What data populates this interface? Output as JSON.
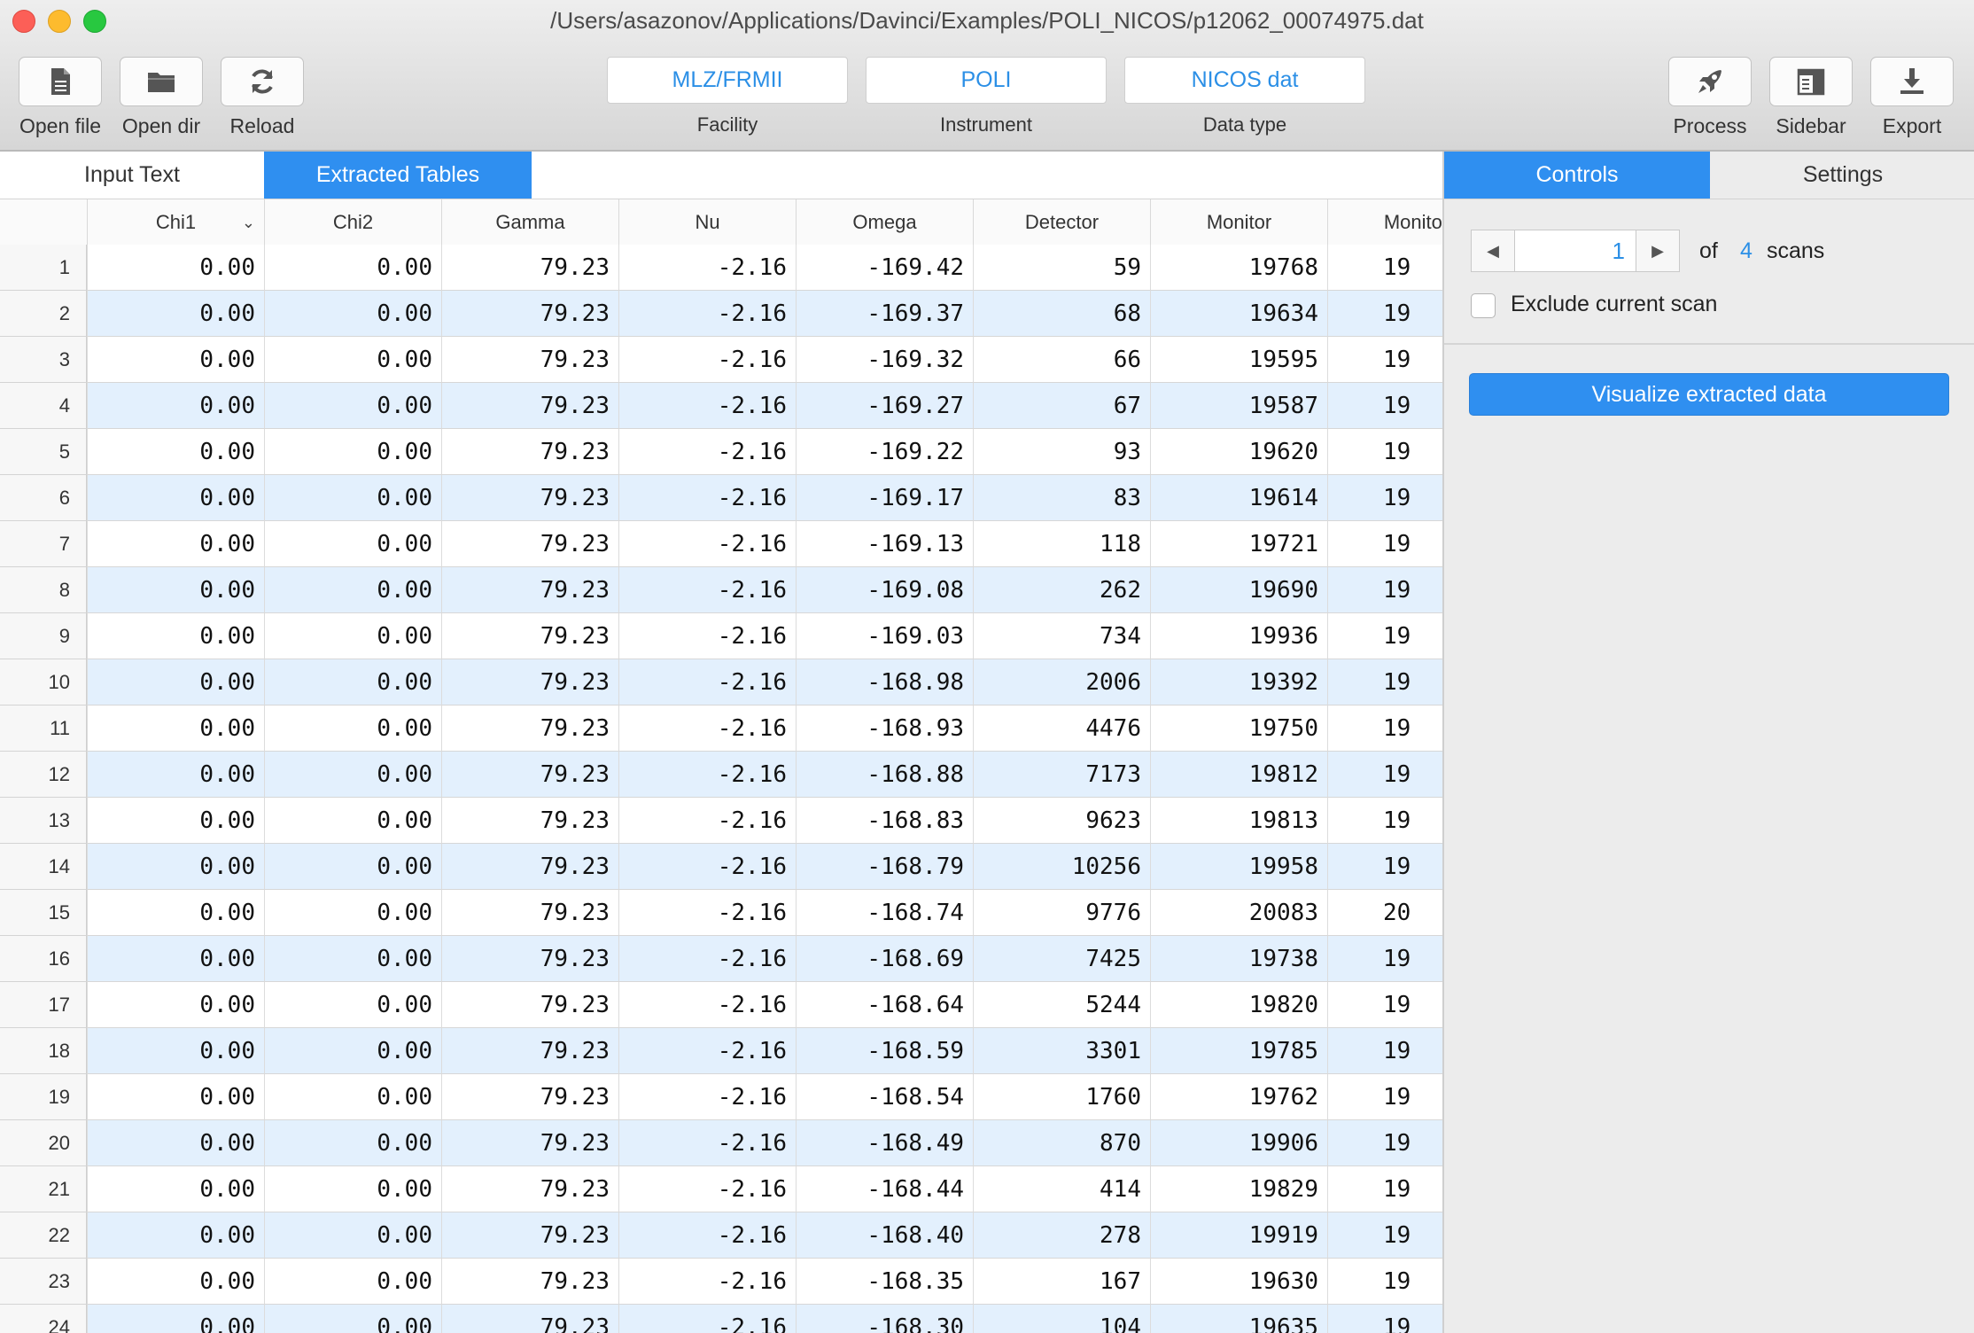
{
  "window": {
    "title": "/Users/asazonov/Applications/Davinci/Examples/POLI_NICOS/p12062_00074975.dat"
  },
  "toolbar": {
    "open_file": "Open file",
    "open_dir": "Open dir",
    "reload": "Reload",
    "facility_value": "MLZ/FRMII",
    "facility_label": "Facility",
    "instrument_value": "POLI",
    "instrument_label": "Instrument",
    "datatype_value": "NICOS dat",
    "datatype_label": "Data type",
    "process": "Process",
    "sidebar": "Sidebar",
    "export": "Export"
  },
  "tabs": {
    "input_text": "Input Text",
    "extracted_tables": "Extracted Tables"
  },
  "table": {
    "columns": [
      "Chi1",
      "Chi2",
      "Gamma",
      "Nu",
      "Omega",
      "Detector",
      "Monitor",
      "Monitor"
    ],
    "rows": [
      [
        "1",
        "0.00",
        "0.00",
        "79.23",
        "-2.16",
        "-169.42",
        "59",
        "19768",
        "19"
      ],
      [
        "2",
        "0.00",
        "0.00",
        "79.23",
        "-2.16",
        "-169.37",
        "68",
        "19634",
        "19"
      ],
      [
        "3",
        "0.00",
        "0.00",
        "79.23",
        "-2.16",
        "-169.32",
        "66",
        "19595",
        "19"
      ],
      [
        "4",
        "0.00",
        "0.00",
        "79.23",
        "-2.16",
        "-169.27",
        "67",
        "19587",
        "19"
      ],
      [
        "5",
        "0.00",
        "0.00",
        "79.23",
        "-2.16",
        "-169.22",
        "93",
        "19620",
        "19"
      ],
      [
        "6",
        "0.00",
        "0.00",
        "79.23",
        "-2.16",
        "-169.17",
        "83",
        "19614",
        "19"
      ],
      [
        "7",
        "0.00",
        "0.00",
        "79.23",
        "-2.16",
        "-169.13",
        "118",
        "19721",
        "19"
      ],
      [
        "8",
        "0.00",
        "0.00",
        "79.23",
        "-2.16",
        "-169.08",
        "262",
        "19690",
        "19"
      ],
      [
        "9",
        "0.00",
        "0.00",
        "79.23",
        "-2.16",
        "-169.03",
        "734",
        "19936",
        "19"
      ],
      [
        "10",
        "0.00",
        "0.00",
        "79.23",
        "-2.16",
        "-168.98",
        "2006",
        "19392",
        "19"
      ],
      [
        "11",
        "0.00",
        "0.00",
        "79.23",
        "-2.16",
        "-168.93",
        "4476",
        "19750",
        "19"
      ],
      [
        "12",
        "0.00",
        "0.00",
        "79.23",
        "-2.16",
        "-168.88",
        "7173",
        "19812",
        "19"
      ],
      [
        "13",
        "0.00",
        "0.00",
        "79.23",
        "-2.16",
        "-168.83",
        "9623",
        "19813",
        "19"
      ],
      [
        "14",
        "0.00",
        "0.00",
        "79.23",
        "-2.16",
        "-168.79",
        "10256",
        "19958",
        "19"
      ],
      [
        "15",
        "0.00",
        "0.00",
        "79.23",
        "-2.16",
        "-168.74",
        "9776",
        "20083",
        "20"
      ],
      [
        "16",
        "0.00",
        "0.00",
        "79.23",
        "-2.16",
        "-168.69",
        "7425",
        "19738",
        "19"
      ],
      [
        "17",
        "0.00",
        "0.00",
        "79.23",
        "-2.16",
        "-168.64",
        "5244",
        "19820",
        "19"
      ],
      [
        "18",
        "0.00",
        "0.00",
        "79.23",
        "-2.16",
        "-168.59",
        "3301",
        "19785",
        "19"
      ],
      [
        "19",
        "0.00",
        "0.00",
        "79.23",
        "-2.16",
        "-168.54",
        "1760",
        "19762",
        "19"
      ],
      [
        "20",
        "0.00",
        "0.00",
        "79.23",
        "-2.16",
        "-168.49",
        "870",
        "19906",
        "19"
      ],
      [
        "21",
        "0.00",
        "0.00",
        "79.23",
        "-2.16",
        "-168.44",
        "414",
        "19829",
        "19"
      ],
      [
        "22",
        "0.00",
        "0.00",
        "79.23",
        "-2.16",
        "-168.40",
        "278",
        "19919",
        "19"
      ],
      [
        "23",
        "0.00",
        "0.00",
        "79.23",
        "-2.16",
        "-168.35",
        "167",
        "19630",
        "19"
      ],
      [
        "24",
        "0.00",
        "0.00",
        "79.23",
        "-2.16",
        "-168.30",
        "104",
        "19635",
        "19"
      ]
    ]
  },
  "right_panel": {
    "tabs": {
      "controls": "Controls",
      "settings": "Settings"
    },
    "current_scan": "1",
    "of_label": "of",
    "scan_count": "4",
    "scans_label": "scans",
    "exclude_label": "Exclude current scan",
    "exclude_checked": false,
    "visualize_button": "Visualize extracted data"
  },
  "colors": {
    "accent": "#2f8ff0",
    "link_text": "#2b8fe6",
    "row_alt": "#e3f0fd"
  }
}
